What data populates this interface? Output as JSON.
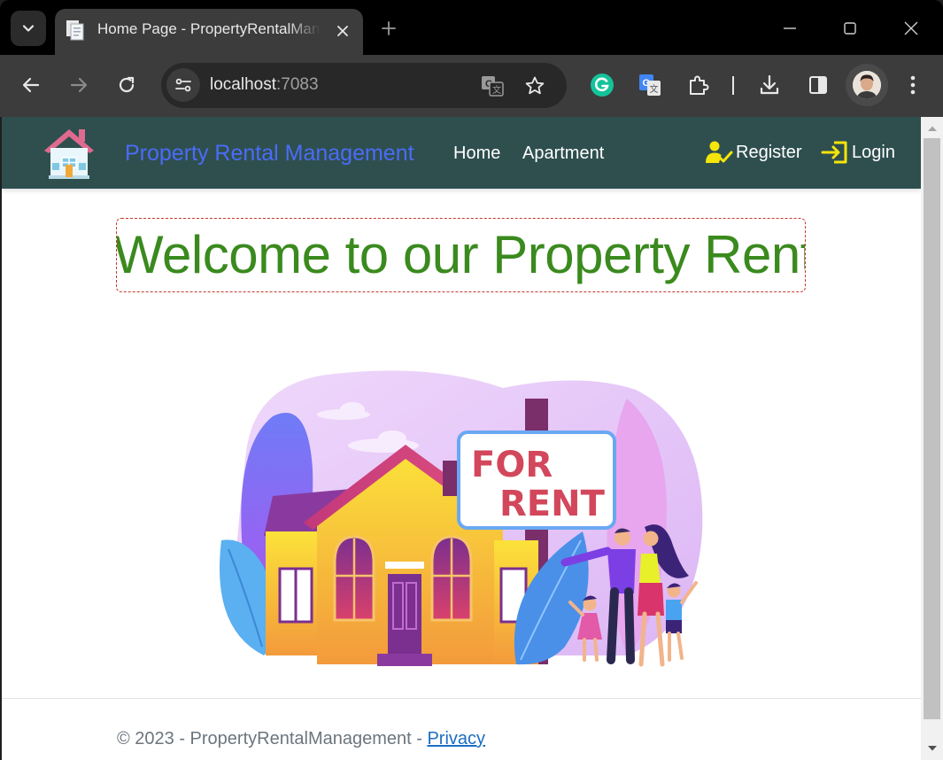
{
  "browser": {
    "tab_title": "Home Page - PropertyRentalManagement",
    "url_host": "localhost",
    "url_port": ":7083"
  },
  "site": {
    "brand": "Property Rental Management",
    "nav": {
      "home": "Home",
      "apartment": "Apartment"
    },
    "auth": {
      "register": "Register",
      "login": "Login"
    },
    "welcome": "Welcome to our Property Rental",
    "hero": {
      "sign_line1": "FOR",
      "sign_line2": "RENT"
    },
    "footer": {
      "copyright": "© 2023 - PropertyRentalManagement - ",
      "privacy": "Privacy"
    }
  },
  "colors": {
    "nav_bg": "#2f4f4f",
    "brand_text": "#4a6cf7",
    "welcome_text": "#3a8a1e",
    "auth_icon": "#f5e50a",
    "link": "#1b6ec2"
  }
}
